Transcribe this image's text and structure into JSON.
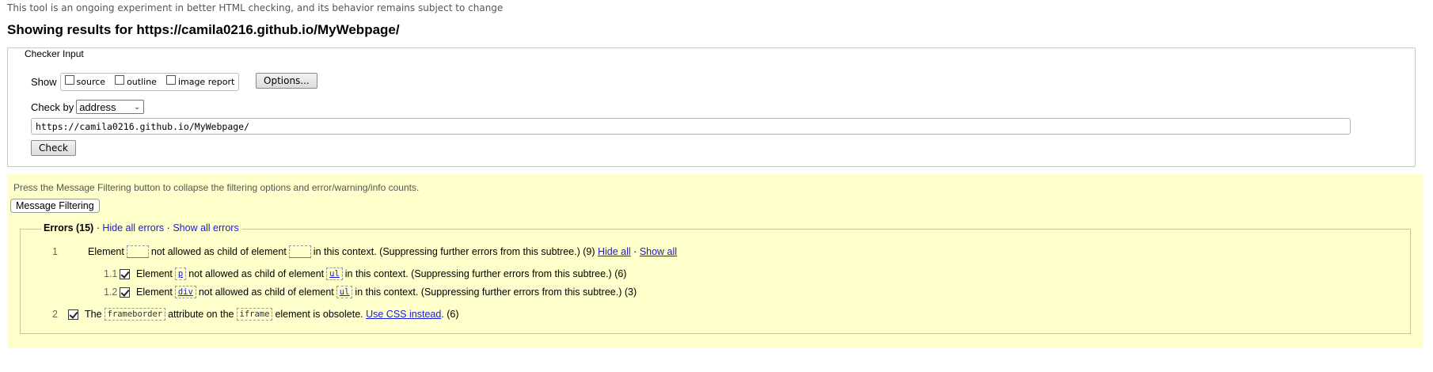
{
  "notice": "This tool is an ongoing experiment in better HTML checking, and its behavior remains subject to change",
  "heading": "Showing results for https://camila0216.github.io/MyWebpage/",
  "checker": {
    "legend": "Checker Input",
    "show_label": "Show",
    "show_options": [
      {
        "label": "source",
        "checked": false
      },
      {
        "label": "outline",
        "checked": false
      },
      {
        "label": "image report",
        "checked": false
      }
    ],
    "options_button": "Options...",
    "check_by_label": "Check by",
    "check_by_value": "address",
    "url_value": "https://camila0216.github.io/MyWebpage/",
    "check_button": "Check"
  },
  "results": {
    "press_text": "Press the Message Filtering button to collapse the filtering options and error/warning/info counts.",
    "message_filtering_button": "Message Filtering",
    "errors_title": "Errors (15)",
    "hide_all_errors": "Hide all errors",
    "show_all_errors": "Show all errors",
    "separator": "·",
    "items": [
      {
        "num": "1",
        "pre": "Element",
        "code1": "",
        "mid": "not allowed as child of element",
        "code2": "",
        "post": "in this context. (Suppressing further errors from this subtree.) (9)",
        "hide_all": "Hide all",
        "show_all": "Show all"
      },
      {
        "num": "1.1",
        "pre": "Element",
        "code1": "p",
        "mid": "not allowed as child of element",
        "code2": "ul",
        "post": "in this context. (Suppressing further errors from this subtree.) (6)"
      },
      {
        "num": "1.2",
        "pre": "Element",
        "code1": "div",
        "mid": "not allowed as child of element",
        "code2": "ul",
        "post": "in this context. (Suppressing further errors from this subtree.) (3)"
      },
      {
        "num": "2",
        "pre": "The",
        "code1": "frameborder",
        "mid": "attribute on the",
        "code2": "iframe",
        "post": "element is obsolete.",
        "link": "Use CSS instead",
        "count": ". (6)"
      }
    ]
  }
}
